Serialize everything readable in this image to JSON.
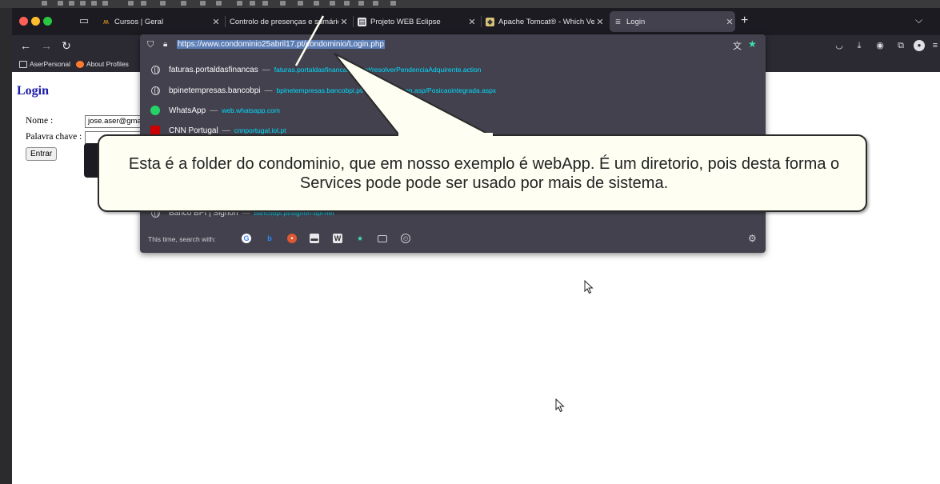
{
  "browser": {
    "tabs": [
      {
        "title": "Cursos | Geral",
        "favicon": "moodle-icon",
        "active": false
      },
      {
        "title": "Controlo de presenças e sumários",
        "favicon": "none",
        "active": false
      },
      {
        "title": "Projeto WEB Eclipse",
        "favicon": "doc-icon",
        "active": false
      },
      {
        "title": "Apache Tomcat® - Which Versi",
        "favicon": "tomcat-icon",
        "active": false
      },
      {
        "title": "Login",
        "favicon": "db-icon",
        "active": true
      }
    ],
    "bookmarks": [
      {
        "label": "AserPersonal",
        "icon": "folder-icon"
      },
      {
        "label": "About Profiles",
        "icon": "firefox-icon"
      }
    ],
    "url": "https://www.condominio25abril17.pt/condominio/Login.php"
  },
  "suggestions": [
    {
      "title": "faturas.portaldasfinancas",
      "url": "faturas.portaldasfinancas.gov.pt/resolverPendenciaAdquirente.action",
      "icon": "globe-icon"
    },
    {
      "title": "bpinetempresas.bancobpi",
      "url": "bpinetempresas.bancobpi.pt/SIGNON/signon.asp/Posicaointegrada.aspx",
      "icon": "globe-icon"
    },
    {
      "title": "WhatsApp",
      "url": "web.whatsapp.com",
      "icon": "whatsapp-icon"
    },
    {
      "title": "CNN Portugal",
      "url": "cnnportugal.iol.pt",
      "icon": "cnn-icon"
    },
    {
      "title": "Banco BPI | Signon",
      "url": "bancobpi.pt/signon-bpi-net",
      "icon": "globe-icon"
    }
  ],
  "search_with": {
    "label": "This time, search with:",
    "engines": [
      "google-icon",
      "bing-icon",
      "duckduckgo-icon",
      "wikipedia-icon",
      "wikipedia-w-icon",
      "bookmarks-star-icon",
      "tabs-icon",
      "history-icon"
    ]
  },
  "page": {
    "title": "Login",
    "nome_label": "Nome :",
    "nome_value": "jose.aser@gmai",
    "pass_label": "Palavra chave :",
    "pass_value": "",
    "submit_label": "Entrar"
  },
  "callout": {
    "text": "Esta é a folder do condominio, que em nosso exemplo é webApp. É um diretorio, pois desta forma o Services pode pode ser usado por mais de sistema."
  }
}
